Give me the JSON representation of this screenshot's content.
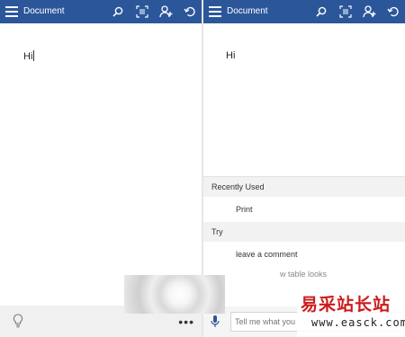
{
  "left_pane": {
    "title": "Document",
    "document_text": "Hi",
    "icons": [
      "menu-icon",
      "search-icon",
      "focus-icon",
      "share-person-icon",
      "undo-icon",
      "lightbulb-icon",
      "more-icon"
    ],
    "more_label": "•••"
  },
  "right_pane": {
    "title": "Document",
    "document_text": "Hi",
    "menu": {
      "recent_header": "Recently Used",
      "recent_item": "Print",
      "try_header": "Try",
      "try_item": "leave a comment",
      "partial_item": "w table looks"
    },
    "tell_me_placeholder": "Tell me what you"
  },
  "watermark": {
    "chinese": "易采站长站",
    "url": "www.easck.com"
  },
  "colors": {
    "titlebar": "#2b579a",
    "watermark_red": "#cc1b1b"
  }
}
